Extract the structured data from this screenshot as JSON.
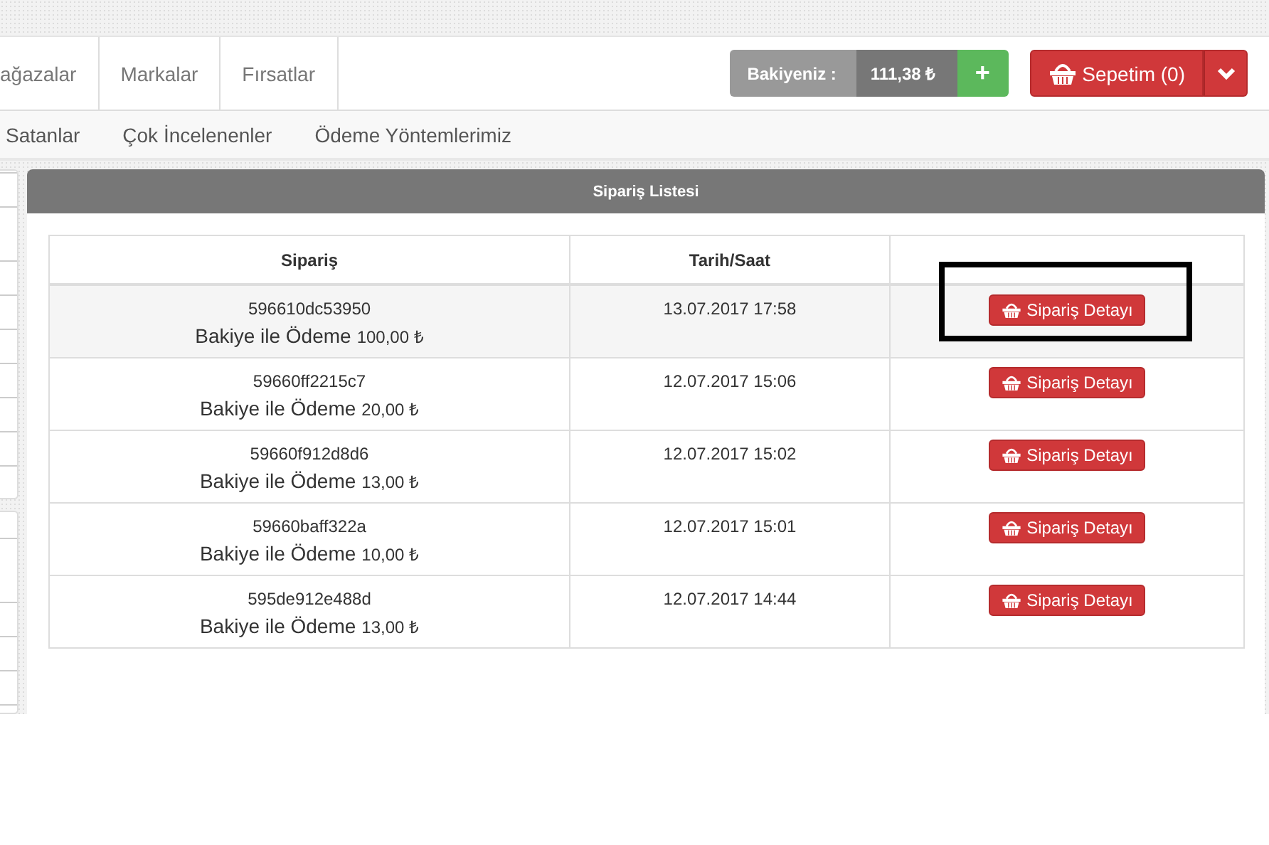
{
  "nav": {
    "items": [
      {
        "label": "ağazalar"
      },
      {
        "label": "Markalar"
      },
      {
        "label": "Fırsatlar"
      }
    ],
    "balance": {
      "label": "Bakiyeniz :",
      "amount": "111,38 ₺",
      "add": "+"
    },
    "cart": {
      "label": "Sepetim (0)"
    }
  },
  "subnav": {
    "items": [
      {
        "label": "Satanlar"
      },
      {
        "label": "Çok İncelenenler"
      },
      {
        "label": "Ödeme Yöntemlerimiz"
      }
    ]
  },
  "panel": {
    "title": "Sipariş Listesi",
    "table": {
      "columns": [
        "Sipariş",
        "Tarih/Saat"
      ],
      "rows": [
        {
          "order_id": "596610dc53950",
          "payment": "Bakiye ile Ödeme",
          "amount": "100,00 ₺",
          "datetime": "13.07.2017 17:58",
          "button": "Sipariş Detayı",
          "hovered": true,
          "highlighted": true
        },
        {
          "order_id": "59660ff2215c7",
          "payment": "Bakiye ile Ödeme",
          "amount": "20,00 ₺",
          "datetime": "12.07.2017 15:06",
          "button": "Sipariş Detayı",
          "hovered": false,
          "highlighted": false
        },
        {
          "order_id": "59660f912d8d6",
          "payment": "Bakiye ile Ödeme",
          "amount": "13,00 ₺",
          "datetime": "12.07.2017 15:02",
          "button": "Sipariş Detayı",
          "hovered": false,
          "highlighted": false
        },
        {
          "order_id": "59660baff322a",
          "payment": "Bakiye ile Ödeme",
          "amount": "10,00 ₺",
          "datetime": "12.07.2017 15:01",
          "button": "Sipariş Detayı",
          "hovered": false,
          "highlighted": false
        },
        {
          "order_id": "595de912e488d",
          "payment": "Bakiye ile Ödeme",
          "amount": "13,00 ₺",
          "datetime": "12.07.2017 14:44",
          "button": "Sipariş Detayı",
          "hovered": false,
          "highlighted": false
        }
      ]
    }
  }
}
